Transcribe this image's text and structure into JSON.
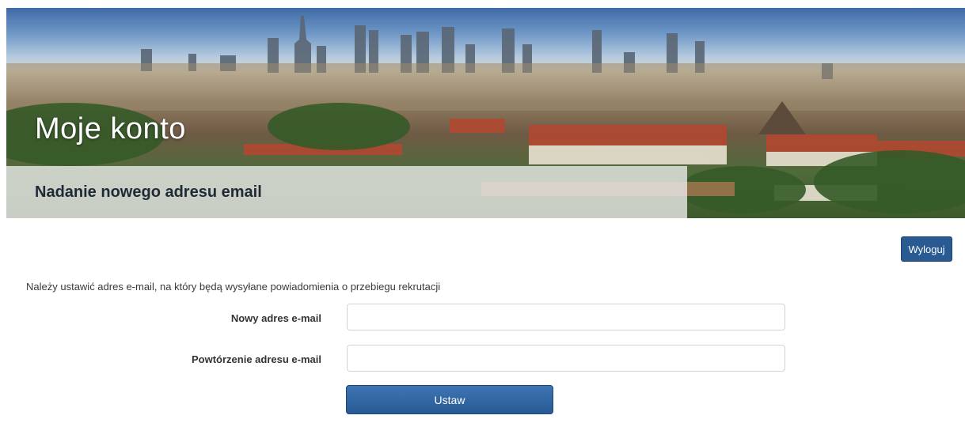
{
  "header": {
    "title": "Moje konto",
    "subtitle": "Nadanie nowego adresu email"
  },
  "toolbar": {
    "logout_label": "Wyloguj"
  },
  "form": {
    "info": "Należy ustawić adres e-mail, na który będą wysyłane powiadomienia o przebiegu rekrutacji",
    "email_label": "Nowy adres e-mail",
    "email_value": "",
    "repeat_label": "Powtórzenie adresu e-mail",
    "repeat_value": "",
    "submit_label": "Ustaw"
  },
  "colors": {
    "accent": "#2a5a92",
    "band": "#ebebeb"
  }
}
